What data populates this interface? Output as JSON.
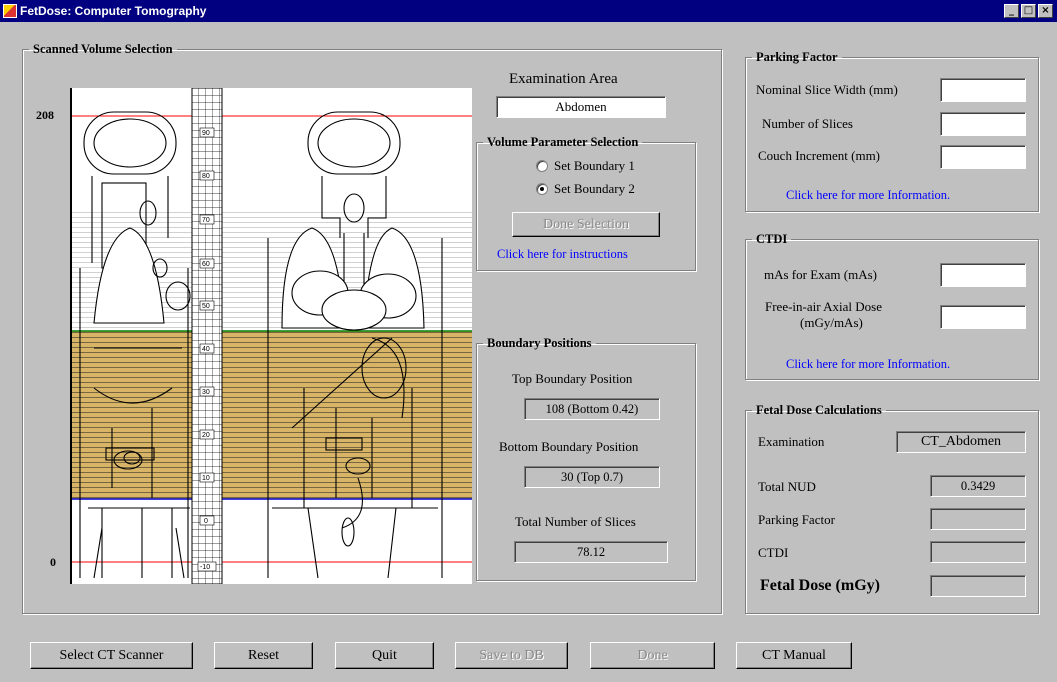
{
  "window": {
    "title": "FetDose: Computer Tomography",
    "controls": [
      "_",
      "□",
      "×"
    ]
  },
  "scan": {
    "group_label": "Scanned Volume Selection",
    "y_top": "208",
    "y_bottom": "0",
    "ruler_labels": [
      "90",
      "80",
      "70",
      "60",
      "50",
      "40",
      "30",
      "20",
      "10",
      "0",
      "-10"
    ],
    "colors": {
      "selection": "#d8b466",
      "top_line": "#008000",
      "bottom_line": "#0000c8",
      "limit_line": "#ff0000"
    }
  },
  "exam": {
    "label": "Examination Area",
    "value": "Abdomen"
  },
  "volume": {
    "group_label": "Volume Parameter Selection",
    "radio1": "Set Boundary 1",
    "radio2": "Set Boundary 2",
    "selected": 2,
    "done_button": "Done Selection",
    "instructions_link": "Click here for instructions"
  },
  "boundary": {
    "group_label": "Boundary Positions",
    "top_label": "Top Boundary Position",
    "top_value": "108 (Bottom 0.42)",
    "bottom_label": "Bottom Boundary Position",
    "bottom_value": "30 (Top 0.7)",
    "slices_label": "Total Number of Slices",
    "slices_value": "78.12"
  },
  "parking": {
    "group_label": "Parking Factor",
    "slice_width_label": "Nominal Slice Width (mm)",
    "slices_label": "Number of Slices",
    "couch_label": "Couch Increment (mm)",
    "info_link": "Click here for more Information."
  },
  "ctdi": {
    "group_label": "CTDI",
    "mas_label": "mAs for Exam (mAs)",
    "dose_label_1": "Free-in-air Axial Dose",
    "dose_label_2": "(mGy/mAs)",
    "info_link": "Click here for more Information."
  },
  "fetal": {
    "group_label": "Fetal Dose Calculations",
    "exam_label": "Examination",
    "exam_value": "CT_Abdomen",
    "nud_label": "Total NUD",
    "nud_value": "0.3429",
    "parking_label": "Parking Factor",
    "ctdi_label": "CTDI",
    "dose_label": "Fetal Dose (mGy)"
  },
  "buttons": {
    "select_scanner": "Select CT Scanner",
    "reset": "Reset",
    "quit": "Quit",
    "save": "Save to DB",
    "done": "Done",
    "manual": "CT Manual"
  }
}
